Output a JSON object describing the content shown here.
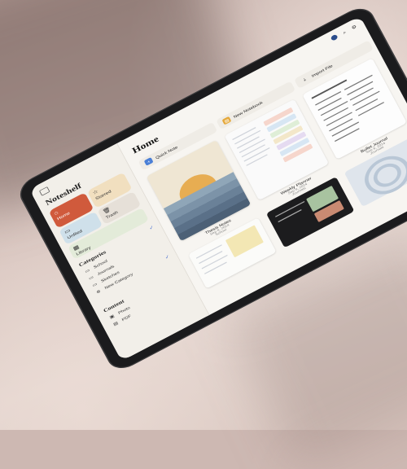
{
  "sidebar": {
    "title": "Noteshelf",
    "tiles": {
      "home": "Home",
      "starred": "Starred",
      "unfiled": "Unfiled",
      "trash": "Trash",
      "library": "Library"
    },
    "categories_heading": "Categories",
    "categories": [
      "School",
      "Journals",
      "Sketches",
      "New Category"
    ],
    "content_heading": "Content",
    "content_items": [
      "Photo",
      "PDF"
    ]
  },
  "main": {
    "title": "Home",
    "actions": {
      "quick_note": "Quick Note",
      "new_notebook": "New Notebook",
      "import_file": "Import File"
    },
    "notebooks": [
      {
        "title": "Thesis Notes",
        "date": "Sep 8, 2024",
        "category": "School"
      },
      {
        "title": "Weekly Planner",
        "date": "Sep 8, 2024",
        "category": "Journals"
      },
      {
        "title": "Bullet Journal",
        "date": "Sep 8, 2024",
        "category": "Journals"
      }
    ]
  },
  "colors": {
    "home_tile": "#d05a3c",
    "starred_tile": "#f1dfbf",
    "unfiled_tile": "#cfe0ea",
    "library_tile": "#e3ebd9",
    "accent": "#4a6fd0"
  }
}
